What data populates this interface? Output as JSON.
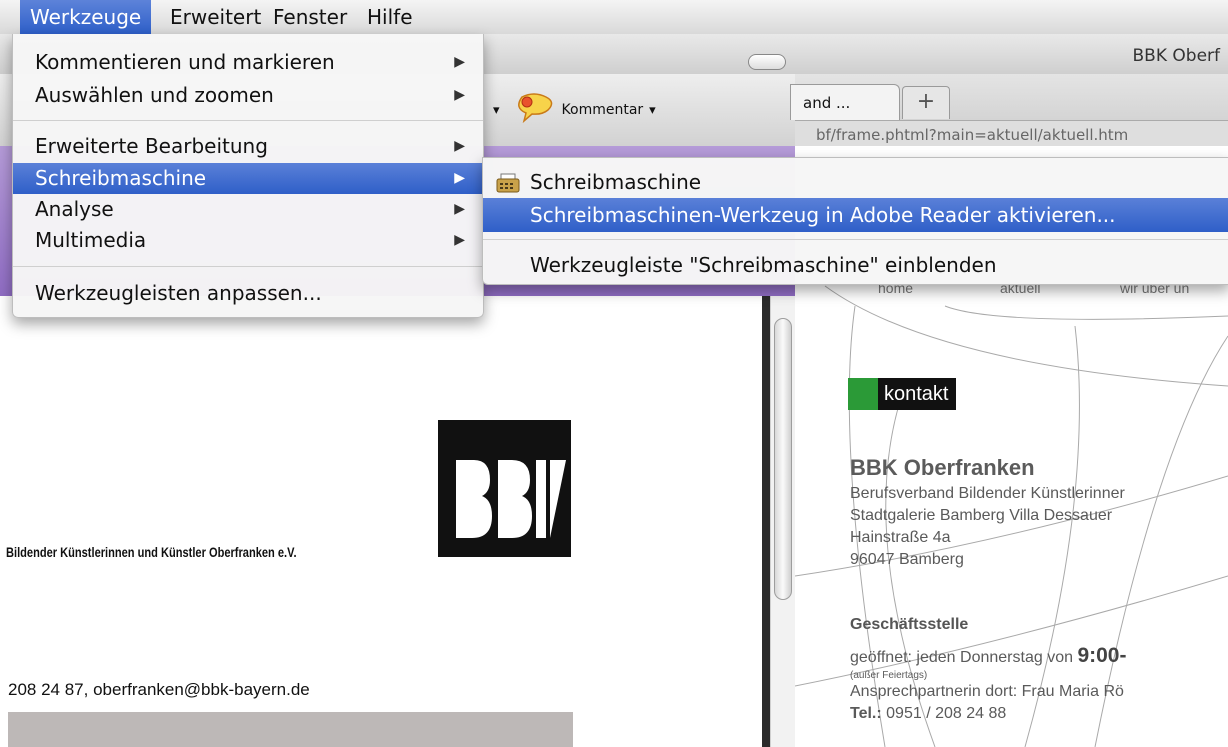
{
  "menubar": {
    "items": [
      {
        "label": "Werkzeuge"
      },
      {
        "label": "Erweitert"
      },
      {
        "label": "Fenster"
      },
      {
        "label": "Hilfe"
      }
    ]
  },
  "menu": {
    "items": [
      {
        "label": "Kommentieren und markieren"
      },
      {
        "label": "Auswählen und zoomen"
      },
      {
        "label": "Erweiterte Bearbeitung"
      },
      {
        "label": "Schreibmaschine"
      },
      {
        "label": "Analyse"
      },
      {
        "label": "Multimedia"
      },
      {
        "label": "Werkzeugleisten anpassen..."
      }
    ],
    "arrow": "▶"
  },
  "submenu": {
    "items": [
      {
        "label": "Schreibmaschine"
      },
      {
        "label": "Schreibmaschinen-Werkzeug in Adobe Reader aktivieren..."
      },
      {
        "label": "Werkzeugleiste \"Schreibmaschine\" einblenden"
      }
    ]
  },
  "acrobat": {
    "toolbar": {
      "kommentar_label": "Kommentar",
      "dropdown_caret": "▾"
    },
    "document": {
      "tagline": "Bildender Künstlerinnen und Künstler Oberfranken e.V.",
      "contact": "208 24 87, oberfranken@bbk-bayern.de"
    }
  },
  "browser": {
    "title": "BBK Oberf",
    "tab_label": "and ...",
    "new_tab_label": "+",
    "url": "bf/frame.phtml?main=aktuell/aktuell.htm",
    "nav": [
      "home",
      "aktuell",
      "wir über un"
    ],
    "page": {
      "section_label": "kontakt",
      "heading": "BBK Oberfranken",
      "address_lines": [
        "Berufsverband Bildender Künstlerinner",
        "Stadtgalerie Bamberg Villa Dessauer",
        "Hainstraße 4a",
        "96047 Bamberg"
      ],
      "office_heading": "Geschäftsstelle",
      "opening_prefix": "geöffnet: jeden Donnerstag von ",
      "opening_time": "9:00-",
      "holiday_note": "(außer Feiertags)",
      "contact_person": "Ansprechpartnerin dort: Frau Maria Rö",
      "tel_label": "Tel.:",
      "tel_number": " 0951 / 208 24 88"
    }
  },
  "colors": {
    "menu_highlight": "#3a68cf",
    "acrobat_toolbar_accent": "#9a7ccb",
    "kontakt_green": "#2b9a37"
  }
}
